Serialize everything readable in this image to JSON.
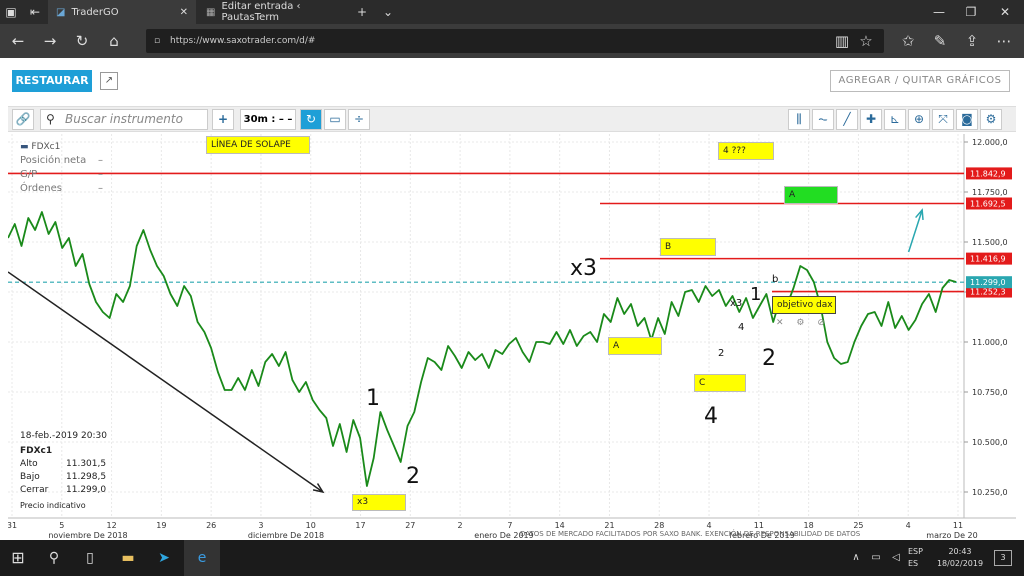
{
  "browser": {
    "tabs": [
      {
        "title": "TraderGO"
      },
      {
        "title": "Editar entrada ‹ PautasTerm"
      }
    ],
    "new_tab": "+",
    "tab_menu": "⌄",
    "window_buttons": [
      "—",
      "❐",
      "✕"
    ],
    "url": "https://www.saxotrader.com/d/#"
  },
  "app": {
    "restaurar_label": "RESTAURAR",
    "add_remove_charts_label": "AGREGAR / QUITAR GRÁFICOS",
    "search_placeholder": "Buscar instrumento",
    "add_label": "+",
    "interval_label": "30m : – –",
    "instrument_header": "FDXc1",
    "info": {
      "position_label": "Posición neta",
      "position_value": "–",
      "pl_label": "G/P",
      "pl_value": "–",
      "orders_label": "Órdenes",
      "orders_value": "–"
    },
    "ohlc": {
      "datetime": "18-feb.-2019 20:30",
      "instrument": "FDXc1",
      "high_label": "Alto",
      "high_value": "11.301,5",
      "low_label": "Bajo",
      "low_value": "11.298,5",
      "close_label": "Cerrar",
      "close_value": "11.299,0",
      "note": "Precio indicativo"
    },
    "annotations": {
      "solape": "LÍNEA DE SOLAPE",
      "four": "4 ???",
      "a_green": "A",
      "b_box": "B",
      "a_box": "A",
      "c_box": "C",
      "x3_box": "x3",
      "objetivo": "objetivo dax",
      "x3_top": "x3",
      "one_left": "1",
      "two_left": "2",
      "four_big": "4",
      "two_right": "2",
      "one_right": "1",
      "small_two": "2",
      "small_four": "4",
      "small_x3": "x3",
      "b_small": "b"
    }
  },
  "chart_data": {
    "type": "line",
    "ylim": [
      10120,
      12040
    ],
    "y_ticks": [
      "12.000,0",
      "11.750,0",
      "11.500,0",
      "11.250,0",
      "11.000,0",
      "10.750,0",
      "10.500,0",
      "10.250,0"
    ],
    "y_tick_values": [
      12000,
      11750,
      11500,
      11250,
      11000,
      10750,
      10500,
      10250
    ],
    "price_lines": [
      {
        "value": 11842.9,
        "label": "11.842,9",
        "color": "#e31b1b"
      },
      {
        "value": 11692.5,
        "label": "11.692,5",
        "color": "#e31b1b"
      },
      {
        "value": 11416.9,
        "label": "11.416,9",
        "color": "#e31b1b"
      },
      {
        "value": 11252.3,
        "label": "11.252,3",
        "color": "#e31b1b"
      },
      {
        "value": 11299.0,
        "label": "11.299,0",
        "color": "#2aa7b0",
        "dashed": true
      }
    ],
    "x_ticks": [
      "31",
      "5",
      "12",
      "19",
      "26",
      "3",
      "10",
      "17",
      "27",
      "2",
      "7",
      "14",
      "21",
      "28",
      "4",
      "11",
      "18",
      "25",
      "4",
      "11"
    ],
    "x_months": [
      "noviembre De 2018",
      "diciembre De 2018",
      "enero De 2019",
      "febrero De 2019",
      "marzo De 20"
    ],
    "series": [
      {
        "color": "#1a8a1a",
        "values": [
          11520,
          11590,
          11480,
          11620,
          11560,
          11650,
          11540,
          11600,
          11470,
          11520,
          11380,
          11440,
          11290,
          11200,
          11150,
          11120,
          11240,
          11200,
          11280,
          11480,
          11560,
          11460,
          11380,
          11330,
          11240,
          11180,
          11280,
          11230,
          11100,
          11050,
          10970,
          10850,
          10760,
          10760,
          10820,
          10760,
          10860,
          10780,
          10900,
          10940,
          10880,
          10950,
          10810,
          10750,
          10800,
          10710,
          10660,
          10620,
          10480,
          10590,
          10450,
          10610,
          10520,
          10280,
          10420,
          10650,
          10560,
          10480,
          10400,
          10580,
          10650,
          10800,
          10920,
          10900,
          10860,
          10980,
          10930,
          10870,
          10950,
          10910,
          10940,
          10870,
          10960,
          10940,
          10990,
          11020,
          10950,
          10900,
          11000,
          11000,
          10990,
          11050,
          10990,
          11060,
          10980,
          11030,
          11050,
          11000,
          11140,
          11100,
          11220,
          11140,
          11190,
          11080,
          11120,
          11010,
          11120,
          11040,
          11200,
          11130,
          11250,
          11260,
          11200,
          11280,
          11230,
          11260,
          11180,
          11230,
          11150,
          11220,
          11120,
          11180,
          11240,
          11100,
          11210,
          11180,
          11270,
          11380,
          11360,
          11300,
          11180,
          11000,
          10920,
          10890,
          10900,
          11000,
          11080,
          11140,
          11150,
          11080,
          11200,
          11070,
          11130,
          11060,
          11110,
          11190,
          11240,
          11150,
          11270,
          11310,
          11300
        ]
      }
    ],
    "arrows": [
      {
        "from": [
          0,
          11350
        ],
        "to": [
          40,
          10250
        ],
        "color": "#222"
      },
      {
        "from": [
          133,
          11450
        ],
        "to": [
          135,
          11660
        ],
        "color": "#2aa7b0"
      }
    ],
    "n_points": 141
  },
  "taskbar": {
    "lang_top": "ESP",
    "lang_bottom": "ES",
    "time": "20:43",
    "date": "18/02/2019",
    "notifications": "3"
  },
  "watermark": "DATOS DE MERCADO FACILITADOS POR SAXO BANK. EXENCIÓN DE RESPONSABILIDAD DE DATOS"
}
